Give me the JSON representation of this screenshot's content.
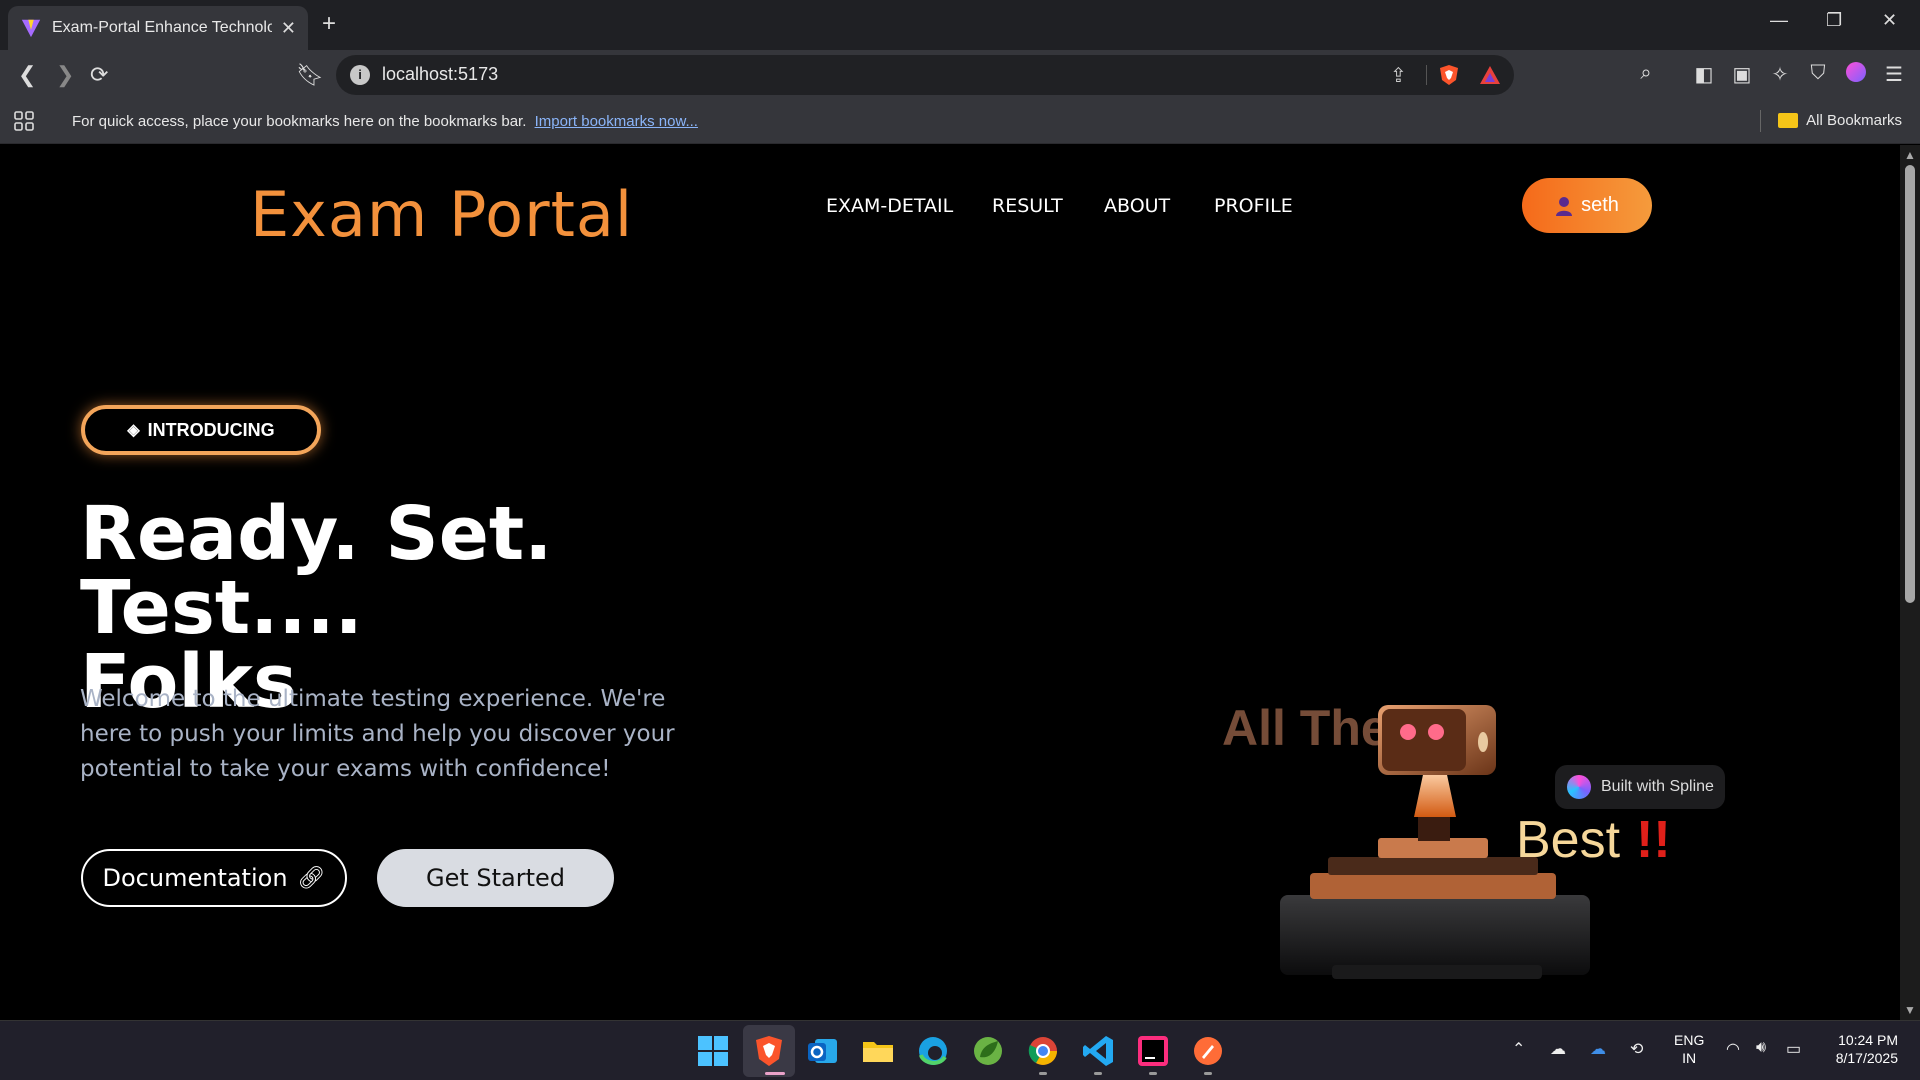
{
  "browser": {
    "tab_title": "Exam-Portal Enhance Technologi",
    "tab_close": "✕",
    "new_tab": "+",
    "url": "localhost:5173",
    "bookmarks_message": "For quick access, place your bookmarks here on the bookmarks bar.",
    "import_link": "Import bookmarks now...",
    "all_bookmarks": "All Bookmarks"
  },
  "site": {
    "logo": "Exam Portal",
    "nav": [
      "EXAM-DETAIL",
      "RESULT",
      "ABOUT",
      "PROFILE"
    ],
    "user_name": "seth"
  },
  "hero": {
    "badge": "INTRODUCING",
    "title_line1": "Ready. Set. Test....",
    "title_line2": "Folks",
    "subtitle": "Welcome to the ultimate testing experience. We're here to push your limits and help you discover your potential to take your exams with confidence!",
    "doc_button": "Documentation",
    "start_button": "Get Started"
  },
  "scene": {
    "text1": "All The",
    "text2": "Best",
    "text3": "!!",
    "spline_badge": "Built with Spline"
  },
  "taskbar": {
    "lang_line1": "ENG",
    "lang_line2": "IN",
    "time": "10:24 PM",
    "date": "8/17/2025"
  },
  "colors": {
    "accent_orange": "#f3913c",
    "button_light": "#d9dce2"
  }
}
